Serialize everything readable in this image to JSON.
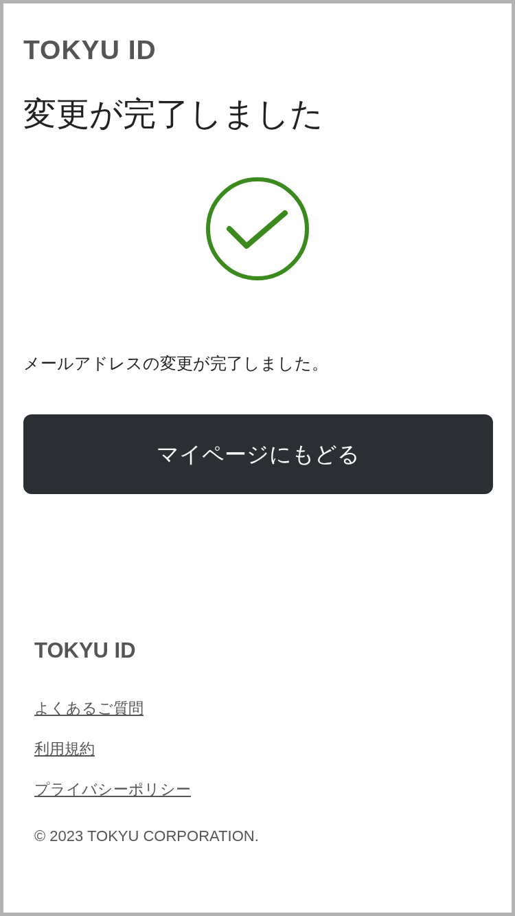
{
  "logo": "TOKYU ID",
  "title": "変更が完了しました",
  "message": "メールアドレスの変更が完了しました。",
  "button": "マイページにもどる",
  "footer": {
    "logo": "TOKYU ID",
    "links": [
      "よくあるご質問",
      "利用規約",
      "プライバシーポリシー"
    ],
    "copyright": "© 2023 TOKYU CORPORATION."
  }
}
